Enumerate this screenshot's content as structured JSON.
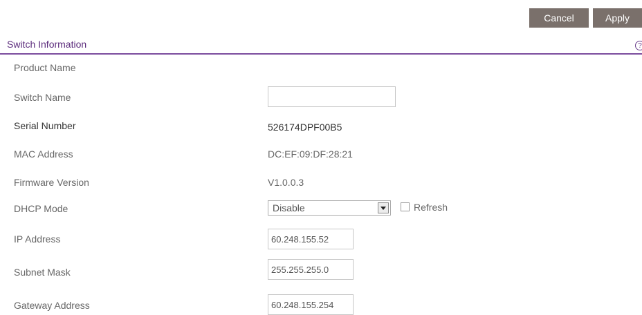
{
  "toolbar": {
    "cancel_label": "Cancel",
    "apply_label": "Apply"
  },
  "section": {
    "title": "Switch Information",
    "help_icon": "?"
  },
  "fields": {
    "product_name": {
      "label": "Product Name",
      "value": ""
    },
    "switch_name": {
      "label": "Switch Name",
      "value": ""
    },
    "serial_number": {
      "label": "Serial Number",
      "value": "526174DPF00B5"
    },
    "mac_address": {
      "label": "MAC Address",
      "value": "DC:EF:09:DF:28:21"
    },
    "firmware_version": {
      "label": "Firmware Version",
      "value": "V1.0.0.3"
    },
    "dhcp_mode": {
      "label": "DHCP Mode",
      "value": "Disable",
      "refresh_label": "Refresh",
      "refresh_checked": false
    },
    "ip_address": {
      "label": "IP Address",
      "value": "60.248.155.52"
    },
    "subnet_mask": {
      "label": "Subnet Mask",
      "value": "255.255.255.0"
    },
    "gateway_address": {
      "label": "Gateway Address",
      "value": "60.248.155.254"
    }
  },
  "colors": {
    "button": "#7a706b",
    "accent": "#7b4d9e",
    "title": "#5b2b7c"
  }
}
